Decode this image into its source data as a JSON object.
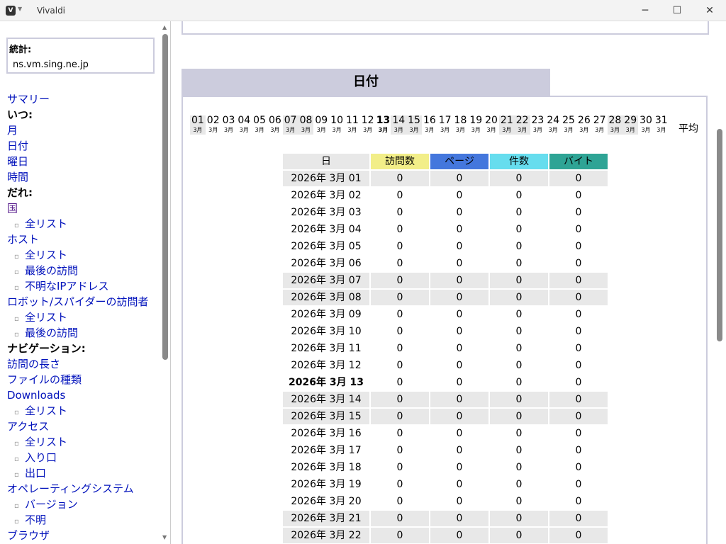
{
  "window": {
    "title": "Vivaldi",
    "logo": "V"
  },
  "sidebar": {
    "stats_label": "統計:",
    "host": "ns.vm.sing.ne.jp",
    "items": [
      {
        "t": "link",
        "label": "サマリー"
      },
      {
        "t": "head",
        "label": "いつ:"
      },
      {
        "t": "link",
        "label": "月"
      },
      {
        "t": "link",
        "label": "日付"
      },
      {
        "t": "link",
        "label": "曜日"
      },
      {
        "t": "link",
        "label": "時間"
      },
      {
        "t": "head",
        "label": "だれ:"
      },
      {
        "t": "visited",
        "label": "国"
      },
      {
        "t": "sub",
        "label": "全リスト"
      },
      {
        "t": "link",
        "label": "ホスト"
      },
      {
        "t": "sub",
        "label": "全リスト"
      },
      {
        "t": "sub",
        "label": "最後の訪問"
      },
      {
        "t": "sub",
        "label": "不明なIPアドレス"
      },
      {
        "t": "link",
        "label": "ロボット/スパイダーの訪問者"
      },
      {
        "t": "sub",
        "label": "全リスト"
      },
      {
        "t": "sub",
        "label": "最後の訪問"
      },
      {
        "t": "head",
        "label": "ナビゲーション:"
      },
      {
        "t": "link",
        "label": "訪問の長さ"
      },
      {
        "t": "link",
        "label": "ファイルの種類"
      },
      {
        "t": "link",
        "label": "Downloads"
      },
      {
        "t": "sub",
        "label": "全リスト"
      },
      {
        "t": "link",
        "label": "アクセス"
      },
      {
        "t": "sub",
        "label": "全リスト"
      },
      {
        "t": "sub",
        "label": "入り口"
      },
      {
        "t": "sub",
        "label": "出口"
      },
      {
        "t": "link",
        "label": "オペレーティングシステム"
      },
      {
        "t": "sub",
        "label": "バージョン"
      },
      {
        "t": "sub",
        "label": "不明"
      },
      {
        "t": "link",
        "label": "ブラウザ"
      }
    ]
  },
  "main": {
    "section_title": "日付",
    "month_label": "3月",
    "avg_label": "平均",
    "today": "13",
    "weekend_days": [
      "01",
      "07",
      "08",
      "14",
      "15",
      "21",
      "22",
      "28",
      "29"
    ],
    "headers": [
      "日",
      "訪問数",
      "ページ",
      "件数",
      "バイト"
    ],
    "header_colors": [
      "#e8e8e8",
      "#f2ee88",
      "#4477dd",
      "#66ddee",
      "#2ea495"
    ],
    "date_prefix": "2026年 3月",
    "rows": [
      [
        "01",
        "0",
        "0",
        "0",
        "0"
      ],
      [
        "02",
        "0",
        "0",
        "0",
        "0"
      ],
      [
        "03",
        "0",
        "0",
        "0",
        "0"
      ],
      [
        "04",
        "0",
        "0",
        "0",
        "0"
      ],
      [
        "05",
        "0",
        "0",
        "0",
        "0"
      ],
      [
        "06",
        "0",
        "0",
        "0",
        "0"
      ],
      [
        "07",
        "0",
        "0",
        "0",
        "0"
      ],
      [
        "08",
        "0",
        "0",
        "0",
        "0"
      ],
      [
        "09",
        "0",
        "0",
        "0",
        "0"
      ],
      [
        "10",
        "0",
        "0",
        "0",
        "0"
      ],
      [
        "11",
        "0",
        "0",
        "0",
        "0"
      ],
      [
        "12",
        "0",
        "0",
        "0",
        "0"
      ],
      [
        "13",
        "0",
        "0",
        "0",
        "0"
      ],
      [
        "14",
        "0",
        "0",
        "0",
        "0"
      ],
      [
        "15",
        "0",
        "0",
        "0",
        "0"
      ],
      [
        "16",
        "0",
        "0",
        "0",
        "0"
      ],
      [
        "17",
        "0",
        "0",
        "0",
        "0"
      ],
      [
        "18",
        "0",
        "0",
        "0",
        "0"
      ],
      [
        "19",
        "0",
        "0",
        "0",
        "0"
      ],
      [
        "20",
        "0",
        "0",
        "0",
        "0"
      ],
      [
        "21",
        "0",
        "0",
        "0",
        "0"
      ],
      [
        "22",
        "0",
        "0",
        "0",
        "0"
      ]
    ]
  }
}
